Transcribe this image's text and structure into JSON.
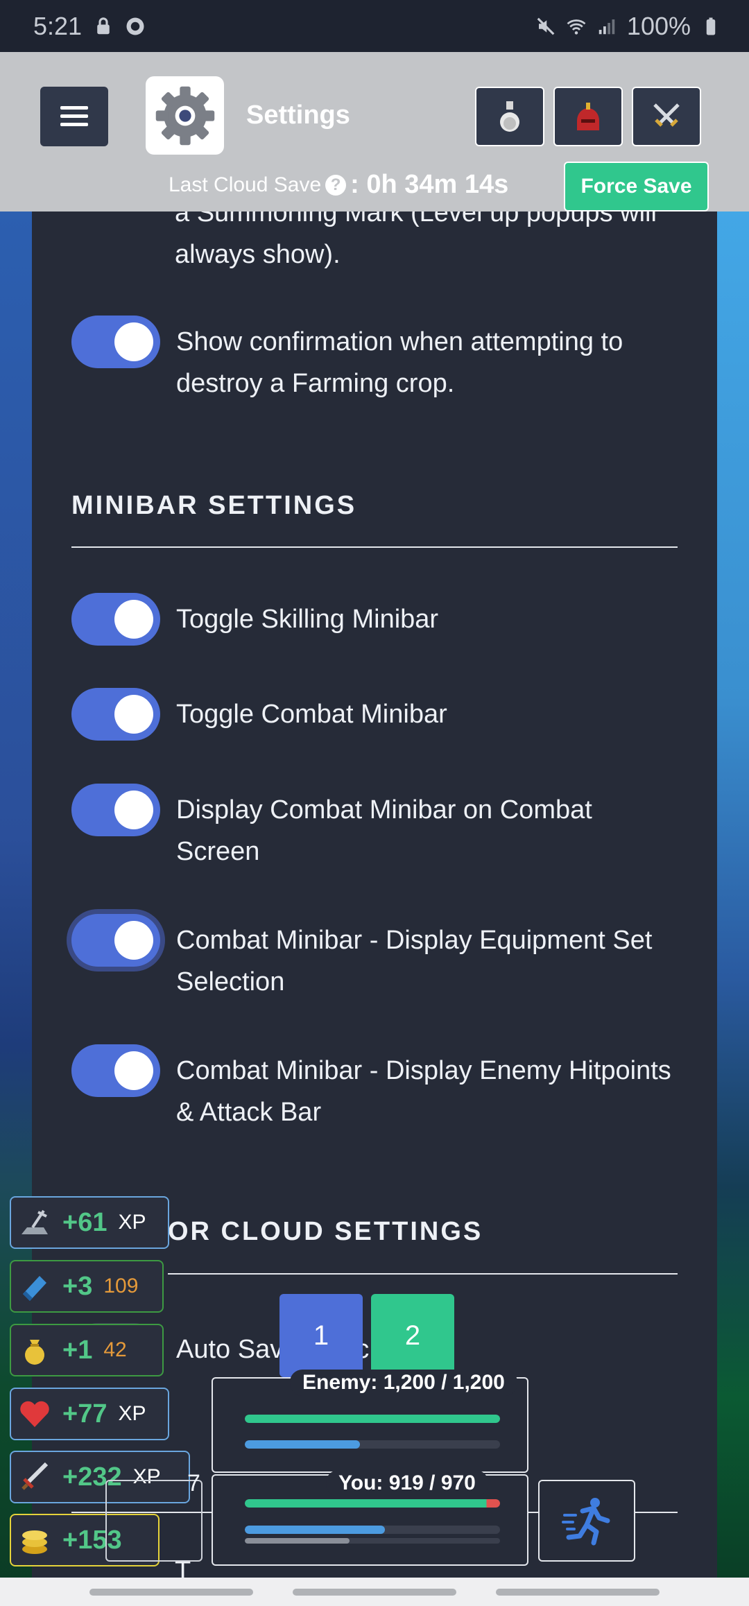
{
  "status_bar": {
    "time": "5:21",
    "battery": "100%"
  },
  "header": {
    "title": "Settings",
    "last_cloud_save_label": "Last Cloud Save",
    "help_symbol": "?",
    "last_cloud_save_time": ": 0h 34m 14s",
    "force_save_label": "Force Save",
    "icons": [
      "menu-icon",
      "gear-icon",
      "potion-icon",
      "helmet-icon",
      "crossed-swords-icon"
    ]
  },
  "settings": {
    "clipped_text": "a Summoning Mark (Level up popups will always show).",
    "farming_confirm": "Show confirmation when attempting to destroy a Farming crop.",
    "minibar_title": "MINIBAR SETTINGS",
    "minibar_items": [
      "Toggle Skilling Minibar",
      "Toggle Combat Minibar",
      "Display Combat Minibar on Combat Screen",
      "Combat Minibar - Display Equipment Set Selection",
      "Combat Minibar - Display Enemy Hitpoints & Attack Bar"
    ],
    "cloud_title": "OR CLOUD SETTINGS",
    "auto_save_partial": "Auto Sav",
    "auto_save_partial_end": "c",
    "partial_bottom": "T",
    "partial_num": "7"
  },
  "notifications": [
    {
      "icon": "pickaxe-icon",
      "amount": "+61",
      "suffix": "XP"
    },
    {
      "icon": "blue-gem-icon",
      "amount": "+3",
      "suffix": "109"
    },
    {
      "icon": "money-bag-icon",
      "amount": "+1",
      "suffix": "42"
    },
    {
      "icon": "heart-icon",
      "amount": "+77",
      "suffix": "XP"
    },
    {
      "icon": "sword-icon",
      "amount": "+232",
      "suffix": "XP"
    },
    {
      "icon": "gold-coins-icon",
      "amount": "+153",
      "suffix": ""
    }
  ],
  "combat": {
    "equipment_sets": [
      "1",
      "2"
    ],
    "enemy_label": "Enemy: 1,200 / 1,200",
    "enemy_hp_fraction": 1.0,
    "enemy_attack_fraction": 0.45,
    "you_label": "You: 919 / 970",
    "you_hp_fraction": 0.947,
    "you_attack_fraction": 0.55,
    "you_secondary_fraction": 0.41,
    "colors": {
      "hp": "#30c78d",
      "hp_loss": "#e0524f",
      "attack": "#4c9be0",
      "secondary": "#8a8f99"
    }
  }
}
